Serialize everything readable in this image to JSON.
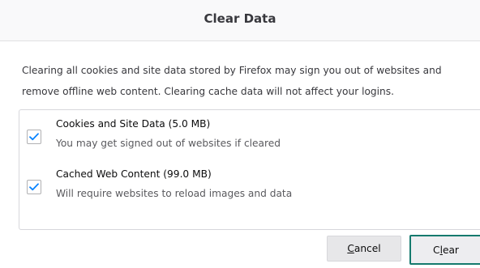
{
  "dialog": {
    "title": "Clear Data",
    "description": "Clearing all cookies and site data stored by Firefox may sign you out of websites and remove offline web content. Clearing cache data will not affect your logins."
  },
  "options": [
    {
      "label": "Cookies and Site Data (5.0 MB)",
      "sublabel": "You may get signed out of websites if cleared",
      "checked": true
    },
    {
      "label": "Cached Web Content (99.0 MB)",
      "sublabel": "Will require websites to reload images and data",
      "checked": true
    }
  ],
  "buttons": {
    "cancel": {
      "accesskey": "C",
      "rest": "ancel"
    },
    "clear": {
      "before": "C",
      "accesskey": "l",
      "after": "ear"
    }
  },
  "colors": {
    "checkmark": "#0a84ff",
    "focus_border": "#157a6e",
    "header_bg": "#f9f9fa"
  },
  "icons": {
    "checkbox": "checkmark-icon"
  }
}
